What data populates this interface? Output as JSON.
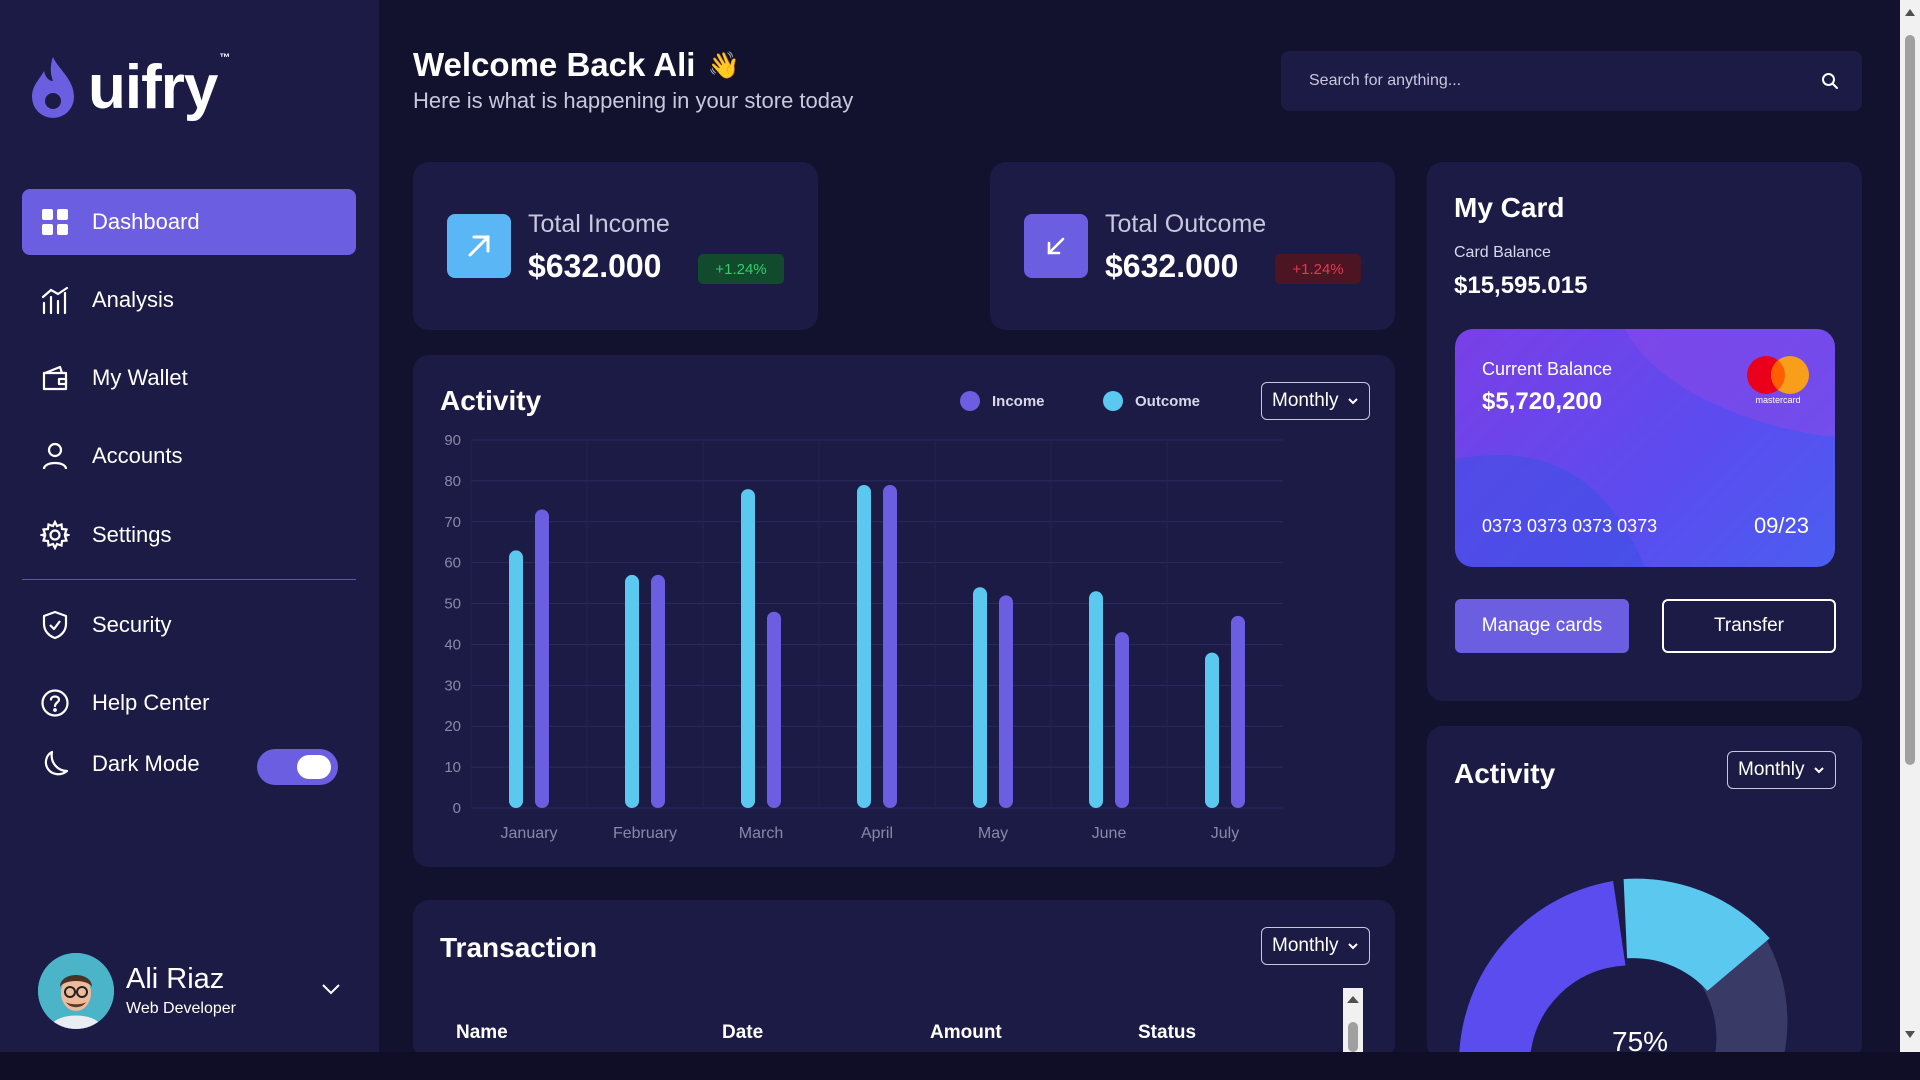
{
  "brand": {
    "name": "uifry",
    "tm": "™"
  },
  "sidebar": {
    "items": [
      {
        "label": "Dashboard",
        "icon": "grid-icon",
        "active": true
      },
      {
        "label": "Analysis",
        "icon": "analysis-icon"
      },
      {
        "label": "My Wallet",
        "icon": "wallet-icon"
      },
      {
        "label": "Accounts",
        "icon": "user-icon"
      },
      {
        "label": "Settings",
        "icon": "gear-icon"
      },
      {
        "label": "Security",
        "icon": "shield-icon"
      },
      {
        "label": "Help Center",
        "icon": "help-icon"
      },
      {
        "label": "Dark Mode",
        "icon": "moon-icon"
      }
    ],
    "dark_mode_on": true
  },
  "profile": {
    "name": "Ali Riaz",
    "role": "Web Developer"
  },
  "header": {
    "welcome": "Welcome Back Ali",
    "wave": "👋",
    "subtitle": "Here is what is happening in your store today",
    "search_placeholder": "Search for anything..."
  },
  "stats": {
    "income": {
      "label": "Total Income",
      "value": "$632.000",
      "change": "+1.24%"
    },
    "outcome": {
      "label": "Total Outcome",
      "value": "$632.000",
      "change": "+1.24%"
    }
  },
  "activity": {
    "title": "Activity",
    "period": "Monthly",
    "legend": {
      "income": "Income",
      "outcome": "Outcome"
    }
  },
  "chart_data": {
    "type": "bar",
    "categories": [
      "January",
      "February",
      "March",
      "April",
      "May",
      "June",
      "July"
    ],
    "series": [
      {
        "name": "Outcome",
        "color": "#5bc8f0",
        "values": [
          63,
          57,
          78,
          79,
          54,
          53,
          38
        ]
      },
      {
        "name": "Income",
        "color": "#6b5ee0",
        "values": [
          73,
          57,
          48,
          79,
          52,
          43,
          47
        ]
      }
    ],
    "yticks": [
      0,
      10,
      20,
      30,
      40,
      50,
      60,
      70,
      80,
      90
    ],
    "ylim": [
      0,
      90
    ],
    "grid": true
  },
  "transaction": {
    "title": "Transaction",
    "period": "Monthly",
    "columns": [
      "Name",
      "Date",
      "Amount",
      "Status"
    ]
  },
  "my_card": {
    "title": "My Card",
    "balance_label": "Card Balance",
    "balance": "$15,595.015",
    "current_label": "Current Balance",
    "current": "$5,720,200",
    "brand": "mastercard",
    "number": "0373 0373 0373 0373",
    "expiry": "09/23",
    "manage_label": "Manage cards",
    "transfer_label": "Transfer"
  },
  "activity_donut": {
    "title": "Activity",
    "period": "Monthly",
    "percent_label": "75%",
    "percent": 75
  }
}
